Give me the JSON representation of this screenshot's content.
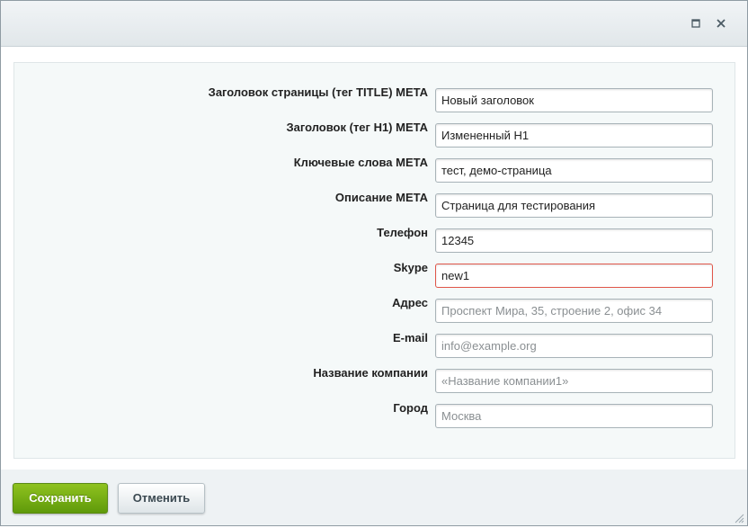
{
  "fields": [
    {
      "label": "Заголовок страницы (тег TITLE) META",
      "value": "Новый заголовок",
      "placeholder": ""
    },
    {
      "label": "Заголовок (тег H1) META",
      "value": "Измененный H1",
      "placeholder": ""
    },
    {
      "label": "Ключевые слова META",
      "value": "тест, демо-страница",
      "placeholder": ""
    },
    {
      "label": "Описание META",
      "value": "Страница для тестирования",
      "placeholder": ""
    },
    {
      "label": "Телефон",
      "value": "12345",
      "placeholder": ""
    },
    {
      "label": "Skype",
      "value": "new1",
      "placeholder": ""
    },
    {
      "label": "Адрес",
      "value": "",
      "placeholder": "Проспект Мира, 35, строение 2, офис 34"
    },
    {
      "label": "E-mail",
      "value": "",
      "placeholder": "info@example.org"
    },
    {
      "label": "Название компании",
      "value": "",
      "placeholder": "«Название компании1»"
    },
    {
      "label": "Город",
      "value": "",
      "placeholder": "Москва"
    }
  ],
  "buttons": {
    "save_label": "Сохранить",
    "cancel_label": "Отменить"
  },
  "colors": {
    "save_button": "#6fa814",
    "focused_border": "#e0574a"
  },
  "icons": {
    "maximize": "maximize-icon",
    "close": "close-icon",
    "resize": "resize-grip-icon"
  }
}
